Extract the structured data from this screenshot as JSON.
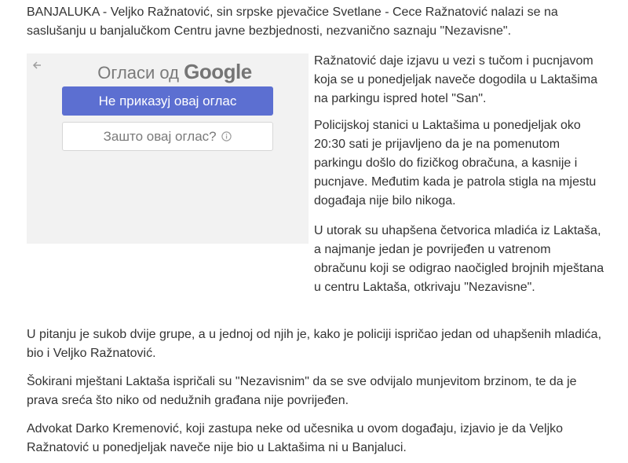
{
  "article": {
    "lead": {
      "dateline": "BANJALUKA -",
      "text": "Veljko Ražnatović, sin srpske pjevačice Svetlane - Cece Ražnatović nalazi se na saslušanju u banjalučkom Centru javne bezbjednosti, nezvanično saznaju \"Nezavisne\"."
    },
    "side_paragraphs": [
      "Ražnatović daje izjavu u vezi s tučom i pucnjavom koja se u ponedjeljak naveče dogodila u Laktašima na parkingu ispred hotel \"San\".",
      "Policijskoj stanici u Laktašima u ponedjeljak oko 20:30 sati je prijavljeno da je na pomenutom parkingu došlo do fizičkog obračuna, a kasnije i pucnjave. Međutim kada je patrola stigla na mjestu događaja nije bilo nikoga.",
      "U utorak su uhapšena četvorica mladića iz Laktaša, a najmanje jedan je povrijeđen u vatrenom obračunu koji se odigrao naočigled brojnih mještana u centru Laktaša, otkrivaju \"Nezavisne\"."
    ],
    "full_paragraphs": [
      "U pitanju je sukob dvije grupe, a u jednoj od njih je, kako je policiji ispričao jedan od uhapšenih mladića, bio i Veljko Ražnatović.",
      "Šokirani mještani Laktaša ispričali su \"Nezavisnim\" da se sve odvijalo munjevitom brzinom, te da je prava sreća što niko od nedužnih građana nije povrijeđen.",
      "Advokat Darko Kremenović, koji zastupa neke od učesnika u ovom događaju, izjavio je da Veljko Ražnatović u ponedjeljak naveče nije bio u Laktašima ni u Banjaluci."
    ]
  },
  "ad": {
    "header_prefix": "Огласи од",
    "header_brand": "Google",
    "stop_button_label": "Не приказуј овај оглас",
    "why_button_label": "Зашто овај оглас?",
    "back_icon": "back-arrow-icon",
    "info_icon": "info-icon",
    "colors": {
      "button": "#5c6fd1",
      "panel": "#f2f2f2",
      "text": "#333333"
    }
  }
}
